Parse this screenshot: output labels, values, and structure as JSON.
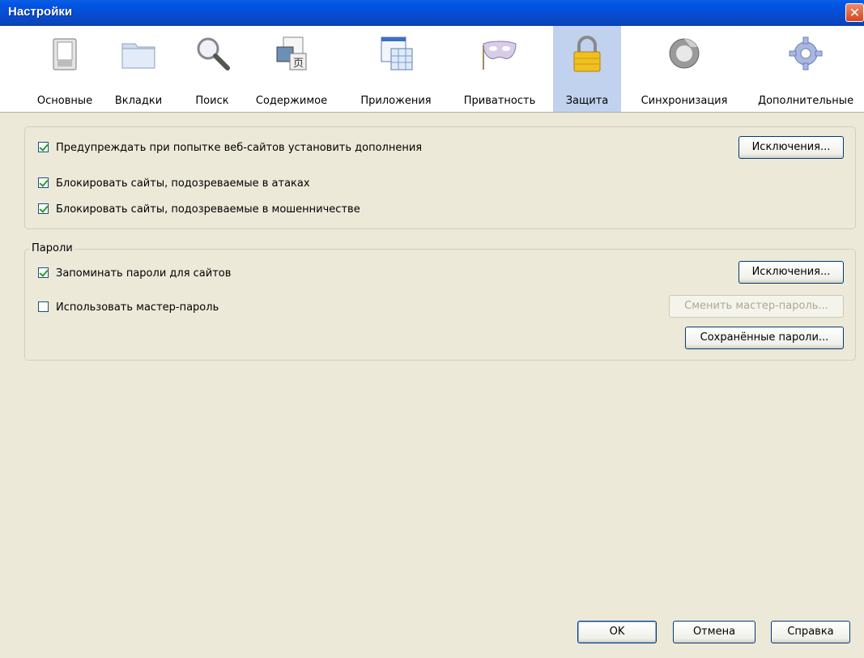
{
  "window": {
    "title": "Настройки",
    "close_glyph": "✕"
  },
  "toolbar": {
    "panes": [
      {
        "label": "Основные",
        "icon": "switch-icon",
        "active": false
      },
      {
        "label": "Вкладки",
        "icon": "folder-tabs-icon",
        "active": false
      },
      {
        "label": "Поиск",
        "icon": "magnifier-icon",
        "active": false
      },
      {
        "label": "Содержимое",
        "icon": "content-icon",
        "active": false
      },
      {
        "label": "Приложения",
        "icon": "applications-icon",
        "active": false
      },
      {
        "label": "Приватность",
        "icon": "mask-icon",
        "active": false
      },
      {
        "label": "Защита",
        "icon": "padlock-icon",
        "active": true
      },
      {
        "label": "Синхронизация",
        "icon": "sync-icon",
        "active": false
      },
      {
        "label": "Дополнительные",
        "icon": "gear-icon",
        "active": false
      }
    ]
  },
  "general_group": {
    "warn_addons": {
      "label": "Предупреждать при попытке веб-сайтов установить дополнения",
      "checked": true
    },
    "addon_exceptions_button": "Исключения...",
    "block_attack": {
      "label": "Блокировать сайты, подозреваемые в атаках",
      "checked": true
    },
    "block_forgery": {
      "label": "Блокировать сайты, подозреваемые в мошенничестве",
      "checked": true
    }
  },
  "passwords_group": {
    "legend": "Пароли",
    "remember": {
      "label": "Запоминать пароли для сайтов",
      "checked": true
    },
    "password_exceptions_button": "Исключения...",
    "master_password": {
      "label": "Использовать мастер-пароль",
      "checked": false
    },
    "change_master_button": "Сменить мастер-пароль...",
    "saved_passwords_button": "Сохранённые пароли..."
  },
  "dialog_buttons": {
    "ok": "OK",
    "cancel": "Отмена",
    "help": "Справка"
  },
  "colors": {
    "titlebar": "#0054e3",
    "dialog_bg": "#ece9d8",
    "active_pane": "#c1d2ee",
    "check": "#21a121"
  }
}
